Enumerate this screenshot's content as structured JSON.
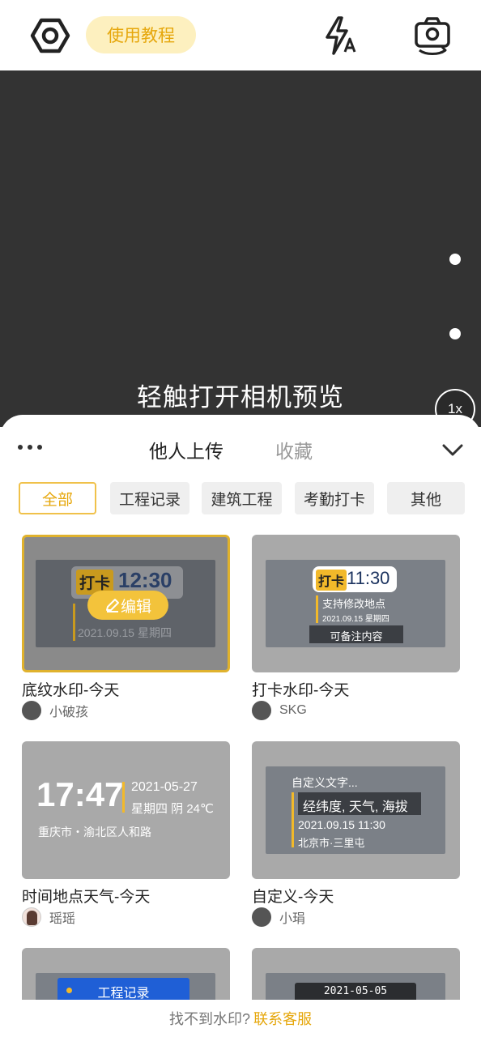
{
  "topbar": {
    "settings_icon": "hex-nut-settings-icon",
    "tutorial_label": "使用教程",
    "flash_icon": "flash-auto-icon",
    "switch_camera_icon": "camera-switch-icon"
  },
  "preview": {
    "hint": "轻触打开相机预览",
    "zoom": "1x"
  },
  "sheet": {
    "tabs": [
      "他人上传",
      "收藏"
    ],
    "active_tab": "他人上传",
    "categories": [
      "全部",
      "工程记录",
      "建筑工程",
      "考勤打卡",
      "其他"
    ],
    "active_category": "全部",
    "cards": [
      {
        "title": "底纹水印-今天",
        "author": "小破孩",
        "selected": true,
        "edit_label": "编辑",
        "wm": {
          "tag": "打卡",
          "time": "12:30",
          "date": "2021.09.15  星期四"
        }
      },
      {
        "title": "打卡水印-今天",
        "author": "SKG",
        "wm": {
          "tag": "打卡",
          "time": "11:30",
          "line1": "支持修改地点",
          "date": "2021.09.15  星期四",
          "note": "可备注内容"
        }
      },
      {
        "title": "时间地点天气-今天",
        "author": "瑶瑶",
        "wm": {
          "time": "17:47",
          "date": "2021-05-27",
          "weather": "星期四 阴 24℃",
          "address": "重庆市・渝北区人和路"
        }
      },
      {
        "title": "自定义-今天",
        "author": "小琄",
        "wm": {
          "line1": "自定义文字...",
          "line2": "经纬度, 天气, 海拔",
          "datetime": "2021.09.15 11:30",
          "place": "北京市·三里屯"
        }
      },
      {
        "wm": {
          "label": "工程记录"
        }
      },
      {
        "wm": {
          "date": "2021-05-05"
        }
      }
    ],
    "footer": {
      "question": "找不到水印?",
      "link": "联系客服"
    }
  },
  "colors": {
    "accent": "#e6a70c",
    "accent_bg": "#fdf0bf",
    "preview_bg": "#333333"
  }
}
